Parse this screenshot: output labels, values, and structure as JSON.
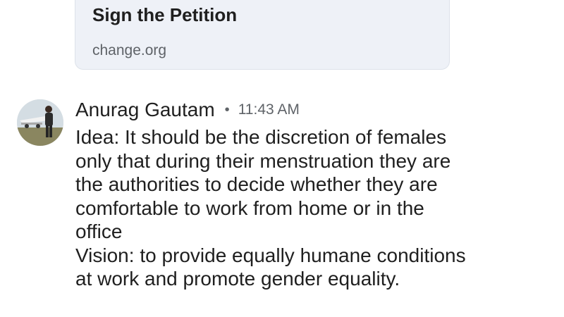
{
  "link_preview": {
    "title": "Sign the Petition",
    "domain": "change.org"
  },
  "message": {
    "sender": "Anurag Gautam",
    "separator": "•",
    "timestamp": "11:43 AM",
    "avatar_icon": "user-photo-avatar",
    "lines": [
      "Idea: It should be the discretion of females",
      "only that during their menstruation they are",
      "the authorities to decide whether they are",
      "comfortable to work from home or in the",
      "office",
      "Vision: to provide equally humane conditions",
      "at work and promote gender equality."
    ]
  },
  "colors": {
    "card_background": "#eef1f7",
    "primary_text": "#1f1f1f",
    "secondary_text": "#5f6368"
  }
}
